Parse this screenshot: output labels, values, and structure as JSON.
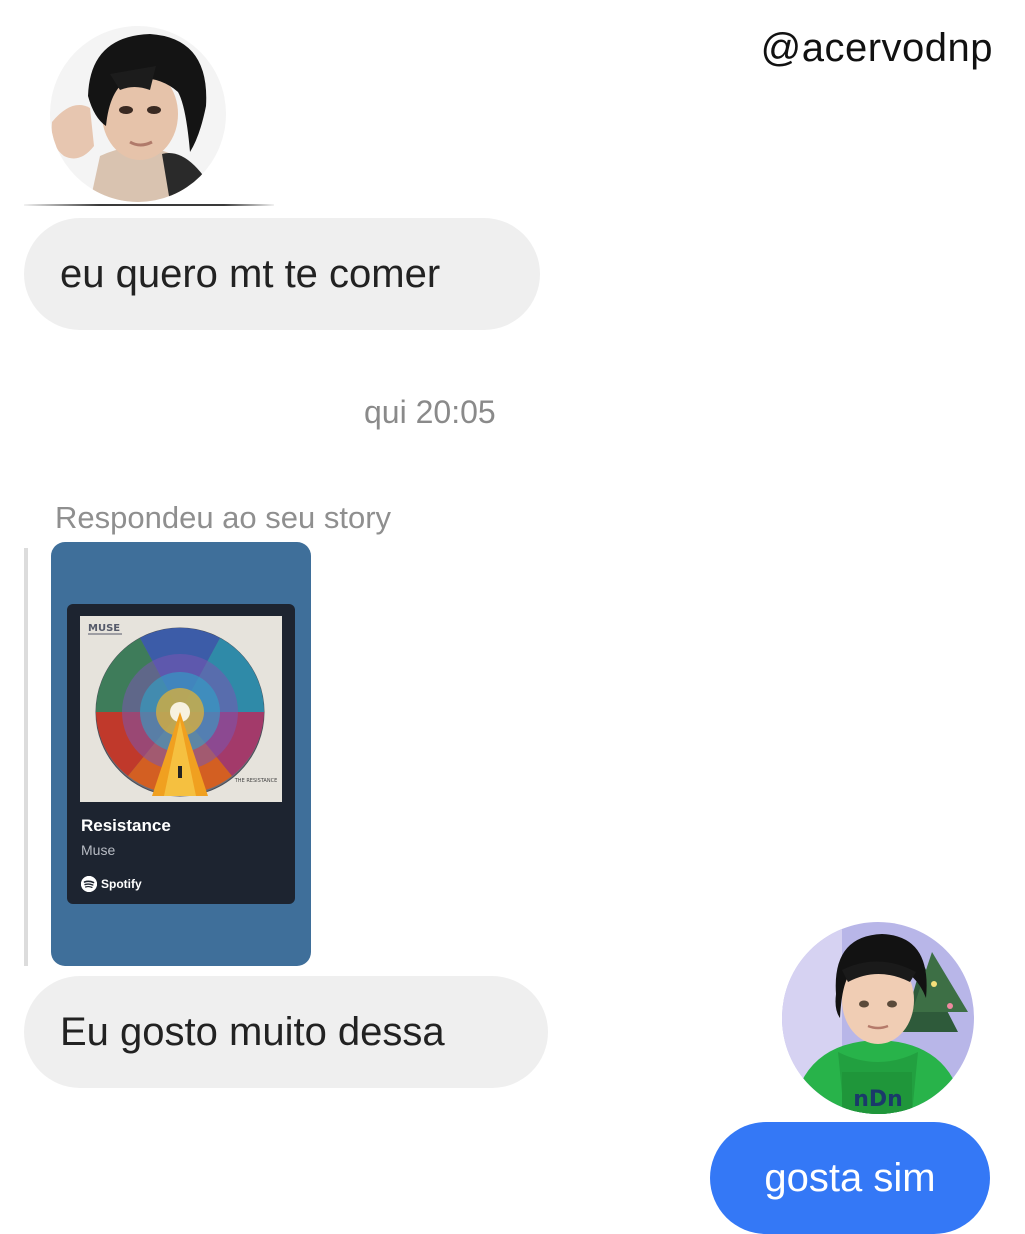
{
  "watermark": "@acervodnp",
  "messages": {
    "incoming_1": "eu quero mt te comer",
    "timestamp": "qui 20:05",
    "reply_label": "Respondeu ao seu story",
    "incoming_2": "Eu gosto muito dessa",
    "outgoing_1": "gosta sim"
  },
  "story": {
    "album_band_text": "MUSE",
    "album_corner_text": "THE RESISTANCE",
    "track_title": "Resistance",
    "artist": "Muse",
    "service": "Spotify",
    "card_color": "#3f6f9a"
  },
  "colors": {
    "incoming_bubble": "#efefef",
    "outgoing_bubble": "#3478f6"
  },
  "avatars": {
    "top": "avatar-photo-dark-hair",
    "bottom": "avatar-photo-green-hoodie"
  }
}
